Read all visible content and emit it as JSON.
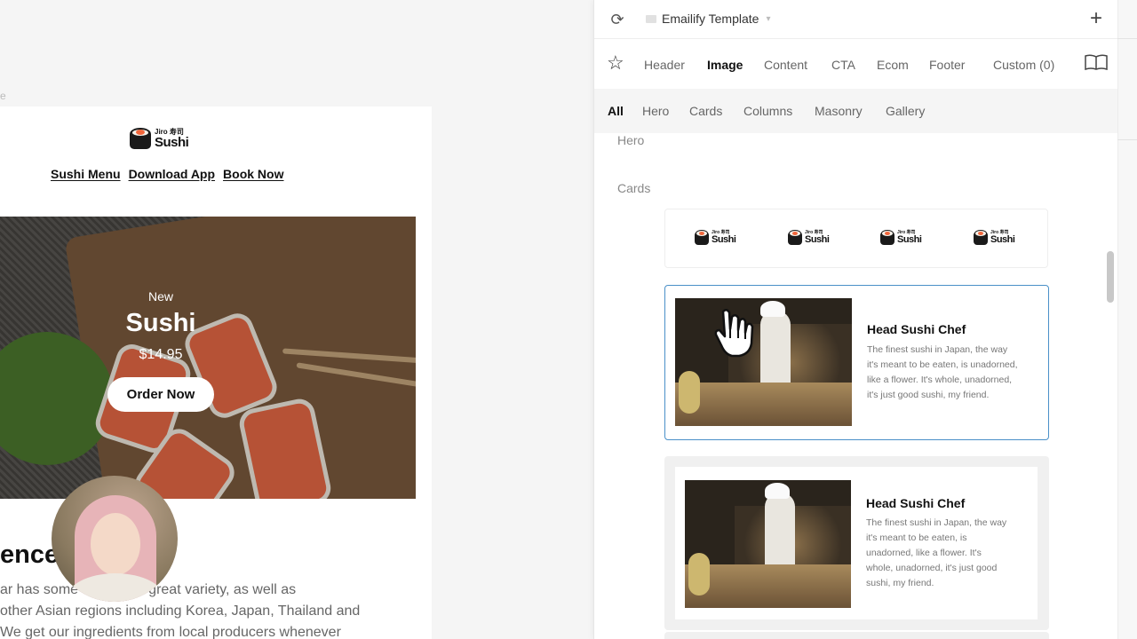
{
  "canvas": {
    "tag": "e",
    "email": {
      "logo": {
        "small": "Jiro 寿司",
        "big": "Sushi"
      },
      "nav": [
        "Sushi Menu",
        "Download App",
        "Book Now"
      ],
      "hero": {
        "kicker": "New",
        "title": "Sushi",
        "price": "$14.95",
        "button": "Order Now"
      },
      "headline": "ence          bar",
      "body_lines": [
        "ar has some               sushi with great variety, as well as",
        " other Asian regions including Korea, Japan, Thailand and",
        "We get our ingredients from local producers whenever"
      ]
    }
  },
  "panel": {
    "template_name": "Emailify Template",
    "categories": [
      "Header",
      "Image",
      "Content",
      "CTA",
      "Ecom",
      "Footer",
      "Custom (0)"
    ],
    "active_category": "Image",
    "subcategories": [
      "All",
      "Hero",
      "Cards",
      "Columns",
      "Masonry",
      "Gallery"
    ],
    "active_subcategory": "All",
    "sections": [
      "Hero",
      "Cards"
    ],
    "logo_row": {
      "small": "Jiro 寿司",
      "big": "Sushi"
    },
    "cards": [
      {
        "title": "Head Sushi Chef",
        "desc_lines": [
          "The finest sushi in Japan, the way",
          "it's meant to be eaten, is unadorned,",
          "like a flower. It's whole, unadorned,",
          "it's just good sushi, my friend."
        ]
      },
      {
        "title": "Head Sushi Chef",
        "desc_lines": [
          "The finest sushi in Japan, the way",
          "it's meant to be eaten, is",
          "unadorned, like a flower. It's",
          "whole, unadorned, it's just good",
          "sushi, my friend."
        ]
      }
    ]
  },
  "colors": {
    "selection": "#4a90c8",
    "accent_text": "#111111",
    "muted": "#666666",
    "salmon": "#e96a46"
  },
  "icons": [
    "refresh-icon",
    "flag-icon",
    "chevron-down-icon",
    "plus-icon",
    "star-icon",
    "book-icon",
    "hand-cursor-icon"
  ]
}
